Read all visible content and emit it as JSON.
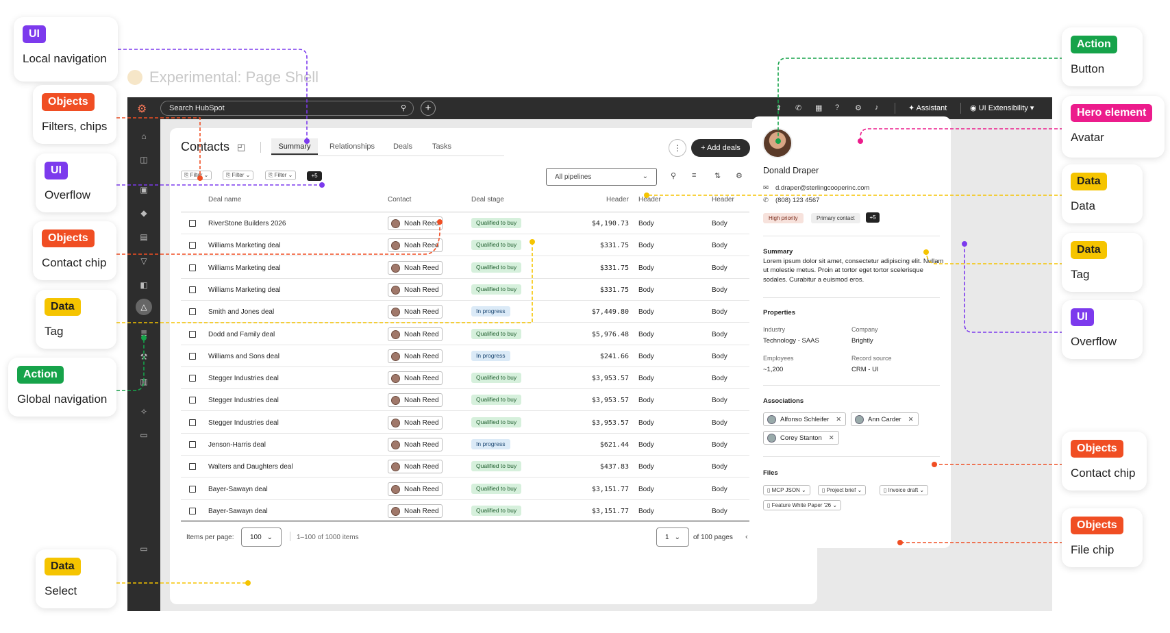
{
  "experimental_title": "Experimental: Page Shell",
  "annotations": [
    {
      "badge": "UI",
      "label": "Local navigation",
      "color": "#7c3aed"
    },
    {
      "badge": "Objects",
      "label": "Filters, chips",
      "color": "#f04e23"
    },
    {
      "badge": "UI",
      "label": "Overflow",
      "color": "#7c3aed"
    },
    {
      "badge": "Objects",
      "label": "Contact chip",
      "color": "#f04e23"
    },
    {
      "badge": "Data",
      "label": "Tag",
      "color": "#f5c400"
    },
    {
      "badge": "Action",
      "label": "Global navigation",
      "color": "#16a34a"
    },
    {
      "badge": "Data",
      "label": "Select",
      "color": "#f5c400"
    },
    {
      "badge": "Action",
      "label": "Button",
      "color": "#16a34a"
    },
    {
      "badge": "Hero element",
      "label": "Avatar",
      "color": "#ec1c8c"
    },
    {
      "badge": "Data",
      "label": "Data",
      "color": "#f5c400"
    },
    {
      "badge": "Data",
      "label": "Tag",
      "color": "#f5c400"
    },
    {
      "badge": "UI",
      "label": "Overflow",
      "color": "#7c3aed"
    },
    {
      "badge": "Objects",
      "label": "Contact chip",
      "color": "#f04e23"
    },
    {
      "badge": "Objects",
      "label": "File chip",
      "color": "#f04e23"
    }
  ],
  "topbar": {
    "search_placeholder": "Search HubSpot",
    "assistant": "Assistant",
    "account": "UI Extensibility"
  },
  "page": {
    "title": "Contacts"
  },
  "tabs": [
    "Summary",
    "Relationships",
    "Deals",
    "Tasks"
  ],
  "add_deals": "Add deals",
  "filters": [
    "Filter",
    "Filter",
    "Filter"
  ],
  "filters_more": "+5",
  "pipelines": "All pipelines",
  "table": {
    "headers": [
      "Deal name",
      "Contact",
      "Deal stage",
      "Header",
      "Header",
      "Header"
    ],
    "rows": [
      {
        "name": "RiverStone Builders 2026",
        "contact": "Noah Reed",
        "stage": "Qualified to buy",
        "amount": "$4,190.73",
        "b1": "Body",
        "b2": "Body"
      },
      {
        "name": "Williams Marketing deal",
        "contact": "Noah Reed",
        "stage": "Qualified to buy",
        "amount": "$331.75",
        "b1": "Body",
        "b2": "Body"
      },
      {
        "name": "Williams Marketing deal",
        "contact": "Noah Reed",
        "stage": "Qualified to buy",
        "amount": "$331.75",
        "b1": "Body",
        "b2": "Body"
      },
      {
        "name": "Williams Marketing deal",
        "contact": "Noah Reed",
        "stage": "Qualified to buy",
        "amount": "$331.75",
        "b1": "Body",
        "b2": "Body"
      },
      {
        "name": "Smith and Jones deal",
        "contact": "Noah Reed",
        "stage": "In progress",
        "amount": "$7,449.80",
        "b1": "Body",
        "b2": "Body"
      },
      {
        "name": "Dodd and Family deal",
        "contact": "Noah Reed",
        "stage": "Qualified to buy",
        "amount": "$5,976.48",
        "b1": "Body",
        "b2": "Body"
      },
      {
        "name": "Williams and Sons deal",
        "contact": "Noah Reed",
        "stage": "In progress",
        "amount": "$241.66",
        "b1": "Body",
        "b2": "Body"
      },
      {
        "name": "Stegger Industries deal",
        "contact": "Noah Reed",
        "stage": "Qualified to buy",
        "amount": "$3,953.57",
        "b1": "Body",
        "b2": "Body"
      },
      {
        "name": "Stegger Industries deal",
        "contact": "Noah Reed",
        "stage": "Qualified to buy",
        "amount": "$3,953.57",
        "b1": "Body",
        "b2": "Body"
      },
      {
        "name": "Stegger Industries deal",
        "contact": "Noah Reed",
        "stage": "Qualified to buy",
        "amount": "$3,953.57",
        "b1": "Body",
        "b2": "Body"
      },
      {
        "name": "Jenson-Harris deal",
        "contact": "Noah Reed",
        "stage": "In progress",
        "amount": "$621.44",
        "b1": "Body",
        "b2": "Body"
      },
      {
        "name": "Walters and Daughters deal",
        "contact": "Noah Reed",
        "stage": "Qualified to buy",
        "amount": "$437.83",
        "b1": "Body",
        "b2": "Body"
      },
      {
        "name": "Bayer-Sawayn deal",
        "contact": "Noah Reed",
        "stage": "Qualified to buy",
        "amount": "$3,151.77",
        "b1": "Body",
        "b2": "Body"
      },
      {
        "name": "Bayer-Sawayn deal",
        "contact": "Noah Reed",
        "stage": "Qualified to buy",
        "amount": "$3,151.77",
        "b1": "Body",
        "b2": "Body"
      }
    ]
  },
  "footer": {
    "items_per_page_label": "Items per page:",
    "items_per_page": "100",
    "range": "1–100 of 1000 items",
    "page": "1",
    "of_pages": "of 100 pages"
  },
  "record": {
    "name": "Donald Draper",
    "email": "d.draper@sterlingcooperinc.com",
    "phone": "(808) 123 4567",
    "tags": [
      "High priority",
      "Primary contact"
    ],
    "tags_more": "+5",
    "summary_title": "Summary",
    "summary": "Lorem ipsum dolor sit amet, consectetur adipiscing elit. Nullam ut molestie metus. Proin at tortor eget tortor scelerisque sodales. Curabitur a euismod eros.",
    "properties_title": "Properties",
    "properties": [
      {
        "label": "Industry",
        "value": "Technology - SAAS"
      },
      {
        "label": "Company",
        "value": "Brightly"
      },
      {
        "label": "Employees",
        "value": "~1,200"
      },
      {
        "label": "Record source",
        "value": "CRM - UI"
      }
    ],
    "associations_title": "Associations",
    "associations": [
      "Alfonso Schleifer",
      "Ann Carder",
      "Corey Stanton"
    ],
    "files_title": "Files",
    "files": [
      "MCP JSON",
      "Project brief",
      "Invoice draft",
      "Feature White Paper '26"
    ]
  }
}
